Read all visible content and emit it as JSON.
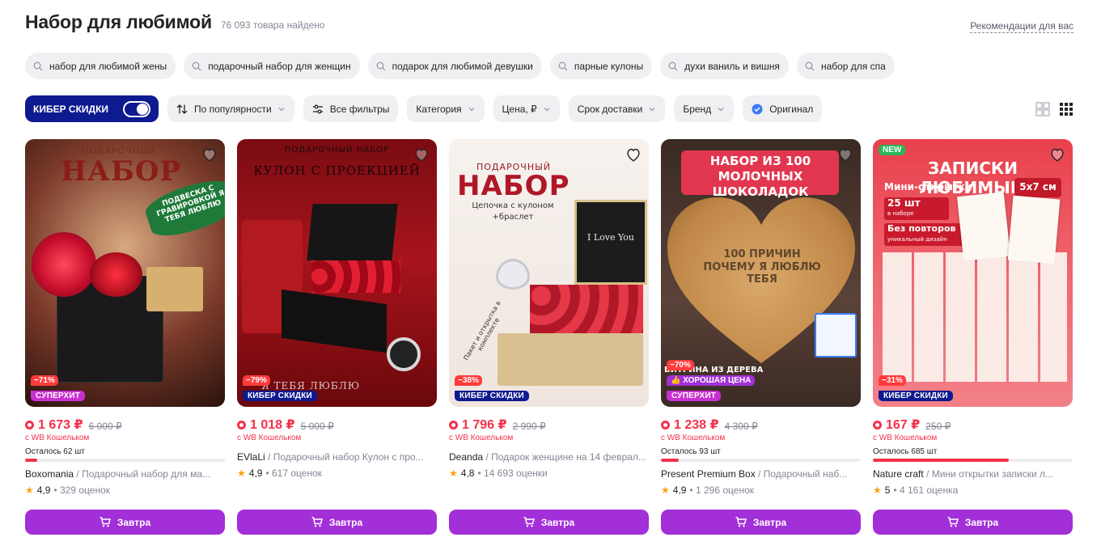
{
  "header": {
    "title": "Набор для любимой",
    "found": "76 093 товара найдено",
    "recommendations": "Рекомендации для вас"
  },
  "suggestions": [
    "набор для любимой жены",
    "подарочный набор для женщин",
    "подарок для любимой девушки",
    "парные кулоны",
    "духи ваниль и вишня",
    "набор для спа"
  ],
  "filters": {
    "cyber_label": "КИБЕР СКИДКИ",
    "cyber_on": true,
    "sort": "По популярности",
    "all_filters": "Все фильтры",
    "category": "Категория",
    "price": "Цена, ₽",
    "delivery": "Срок доставки",
    "brand": "Бренд",
    "original": "Оригинал"
  },
  "colors": {
    "accent": "#a22fd8",
    "price": "#f5314b",
    "cyber": "#0e1a8f",
    "superhit": "#c92fd0"
  },
  "products": [
    {
      "brand": "Boxomania",
      "name": "Подарочный набор для ма...",
      "price": "1 673 ₽",
      "old_price": "6 000 ₽",
      "wallet": "с WB Кошельком",
      "stock_text": "Осталось 62 шт",
      "stock_level": 0.06,
      "rating": "4,9",
      "reviews": "329 оценок",
      "discount": "−71%",
      "badge": "СУПЕРХИТ",
      "badge_type": "superhit",
      "image": {
        "top": "ПОДАРОЧНЫЙ",
        "main": "НАБОР",
        "side": "ПОДВЕСКА С ГРАВИРОВКОЙ Я ТЕБЯ ЛЮБЛЮ"
      },
      "button": "Завтра"
    },
    {
      "brand": "EVlaLi",
      "name": "Подарочный набор Кулон с про...",
      "price": "1 018 ₽",
      "old_price": "5 000 ₽",
      "wallet": "с WB Кошельком",
      "stock_text": "",
      "stock_level": null,
      "rating": "4,9",
      "reviews": "617 оценок",
      "discount": "−79%",
      "badge": "КИБЕР СКИДКИ",
      "badge_type": "cyber",
      "image": {
        "top": "ПОДАРОЧНЫЙ НАБОР",
        "main": "КУЛОН С ПРОЕКЦИЕЙ",
        "bottom": "Я ТЕБЯ ЛЮБЛЮ"
      },
      "button": "Завтра"
    },
    {
      "brand": "Deanda",
      "name": "Подарок женщине на 14 феврал...",
      "price": "1 796 ₽",
      "old_price": "2 990 ₽",
      "wallet": "с WB Кошельком",
      "stock_text": "",
      "stock_level": null,
      "rating": "4,8",
      "reviews": "14 693 оценки",
      "discount": "−38%",
      "badge": "КИБЕР СКИДКИ",
      "badge_type": "cyber",
      "image": {
        "top": "ПОДАРОЧНЫЙ",
        "main": "НАБОР",
        "sub": "Цепочка с кулоном +браслет",
        "box": "I Love You",
        "side": "Пакет и открытка в комплекте"
      },
      "button": "Завтра"
    },
    {
      "brand": "Present Premium Box",
      "name": "Подарочный наб...",
      "price": "1 238 ₽",
      "old_price": "4 300 ₽",
      "wallet": "с WB Кошельком",
      "stock_text": "Осталось 93 шт",
      "stock_level": 0.09,
      "rating": "4,9",
      "reviews": "1 296 оценок",
      "discount": "−70%",
      "badge": "СУПЕРХИТ",
      "badge_type": "superhit",
      "good_price": "ХОРОШАЯ ЦЕНА",
      "image": {
        "main": "НАБОР ИЗ 100 МОЛОЧНЫХ ШОКОЛАДОК",
        "heart": "100 ПРИЧИН ПОЧЕМУ Я ЛЮБЛЮ ТЕБЯ",
        "bottom": "ВИТРИНА ИЗ ДЕРЕВА"
      },
      "button": "Завтра"
    },
    {
      "brand": "Nature craft",
      "name": "Мини открытки записки л...",
      "price": "167 ₽",
      "old_price": "250 ₽",
      "wallet": "с WB Кошельком",
      "stock_text": "Осталось 685 шт",
      "stock_level": 0.68,
      "rating": "5",
      "reviews": "4 161 оценка",
      "discount": "−31%",
      "badge": "КИБЕР СКИДКИ",
      "badge_type": "cyber",
      "new_badge": "NEW",
      "image": {
        "main": "ЗАПИСКИ ЛЮБИМЫМ",
        "sub": "Мини-открытки",
        "size": "5x7 см",
        "count": "25 шт",
        "count_sub": "в наборе",
        "repeat": "Без повторов",
        "repeat_sub": "уникальный дизайн"
      },
      "button": "Завтра"
    }
  ]
}
